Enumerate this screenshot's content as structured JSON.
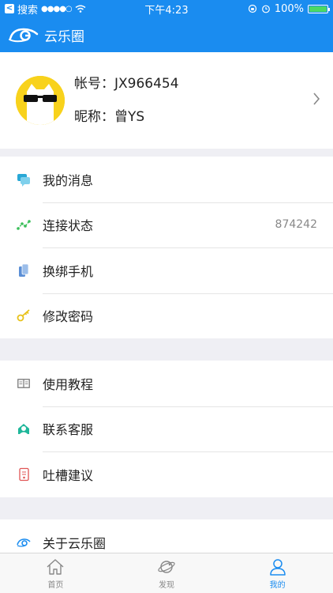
{
  "status_bar": {
    "back_app": "搜索",
    "signal": "●●●●○",
    "time": "下午4:23",
    "battery": "100%",
    "battery_level": 1.0
  },
  "nav": {
    "title": "云乐圈"
  },
  "profile": {
    "account_label": "帐号：",
    "account": "JX966454",
    "nickname_label": "昵称：",
    "nickname": "曾YS"
  },
  "group1": [
    {
      "label": "我的消息",
      "icon": "message-icon"
    },
    {
      "label": "连接状态",
      "icon": "connection-icon",
      "value": "874242"
    },
    {
      "label": "换绑手机",
      "icon": "phone-icon"
    },
    {
      "label": "修改密码",
      "icon": "key-icon"
    }
  ],
  "group2": [
    {
      "label": "使用教程",
      "icon": "book-icon"
    },
    {
      "label": "联系客服",
      "icon": "service-icon"
    },
    {
      "label": "吐槽建议",
      "icon": "feedback-icon"
    }
  ],
  "group3": [
    {
      "label": "关于云乐圈",
      "icon": "about-logo-icon"
    }
  ],
  "tabs": [
    {
      "label": "首页",
      "icon": "home-icon"
    },
    {
      "label": "发现",
      "icon": "planet-icon"
    },
    {
      "label": "我的",
      "icon": "user-icon",
      "active": true
    }
  ],
  "colors": {
    "brand": "#1a8cf0",
    "background": "#efeff4",
    "avatar_bg": "#f8d21c"
  }
}
